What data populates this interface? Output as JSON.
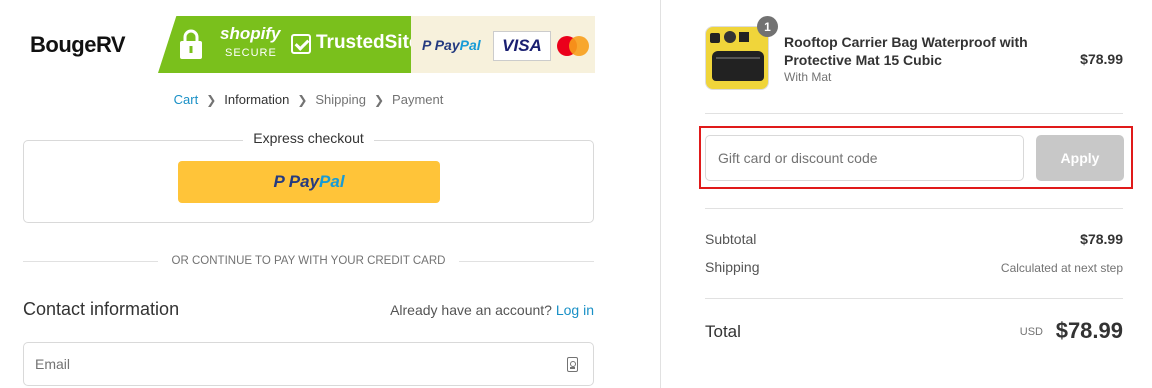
{
  "banner": {
    "logo_text": "BougeRV",
    "shopify_text": "shopify",
    "secure_text": "SECURE",
    "trustedsite_text": "TrustedSite",
    "paypal_pay": "Pay",
    "paypal_pal": "Pal",
    "visa_text": "VISA",
    "colors": {
      "green": "#7ac01c",
      "cream": "#f7f1dc"
    }
  },
  "breadcrumb": {
    "items": [
      "Cart",
      "Information",
      "Shipping",
      "Payment"
    ],
    "separator": ">"
  },
  "express": {
    "title": "Express checkout",
    "paypal_pay": "Pay",
    "paypal_pal": "Pal"
  },
  "divider_text": "OR CONTINUE TO PAY WITH YOUR CREDIT CARD",
  "contact": {
    "title": "Contact information",
    "account_prompt": "Already have an account?",
    "login_link": "Log in",
    "email_placeholder": "Email"
  },
  "order": {
    "product": {
      "quantity": "1",
      "name": "Rooftop Carrier Bag Waterproof with Protective Mat 15 Cubic",
      "variant": "With Mat",
      "price": "$78.99"
    },
    "discount": {
      "placeholder": "Gift card or discount code",
      "apply_label": "Apply"
    },
    "subtotal_label": "Subtotal",
    "subtotal_value": "$78.99",
    "shipping_label": "Shipping",
    "shipping_value": "Calculated at next step",
    "total_label": "Total",
    "total_currency": "USD",
    "total_value": "$78.99"
  },
  "colors": {
    "link": "#1990c6",
    "paypal_button": "#ffc439",
    "highlight_frame": "#e01a1a",
    "apply_disabled": "#c8c8c8"
  }
}
